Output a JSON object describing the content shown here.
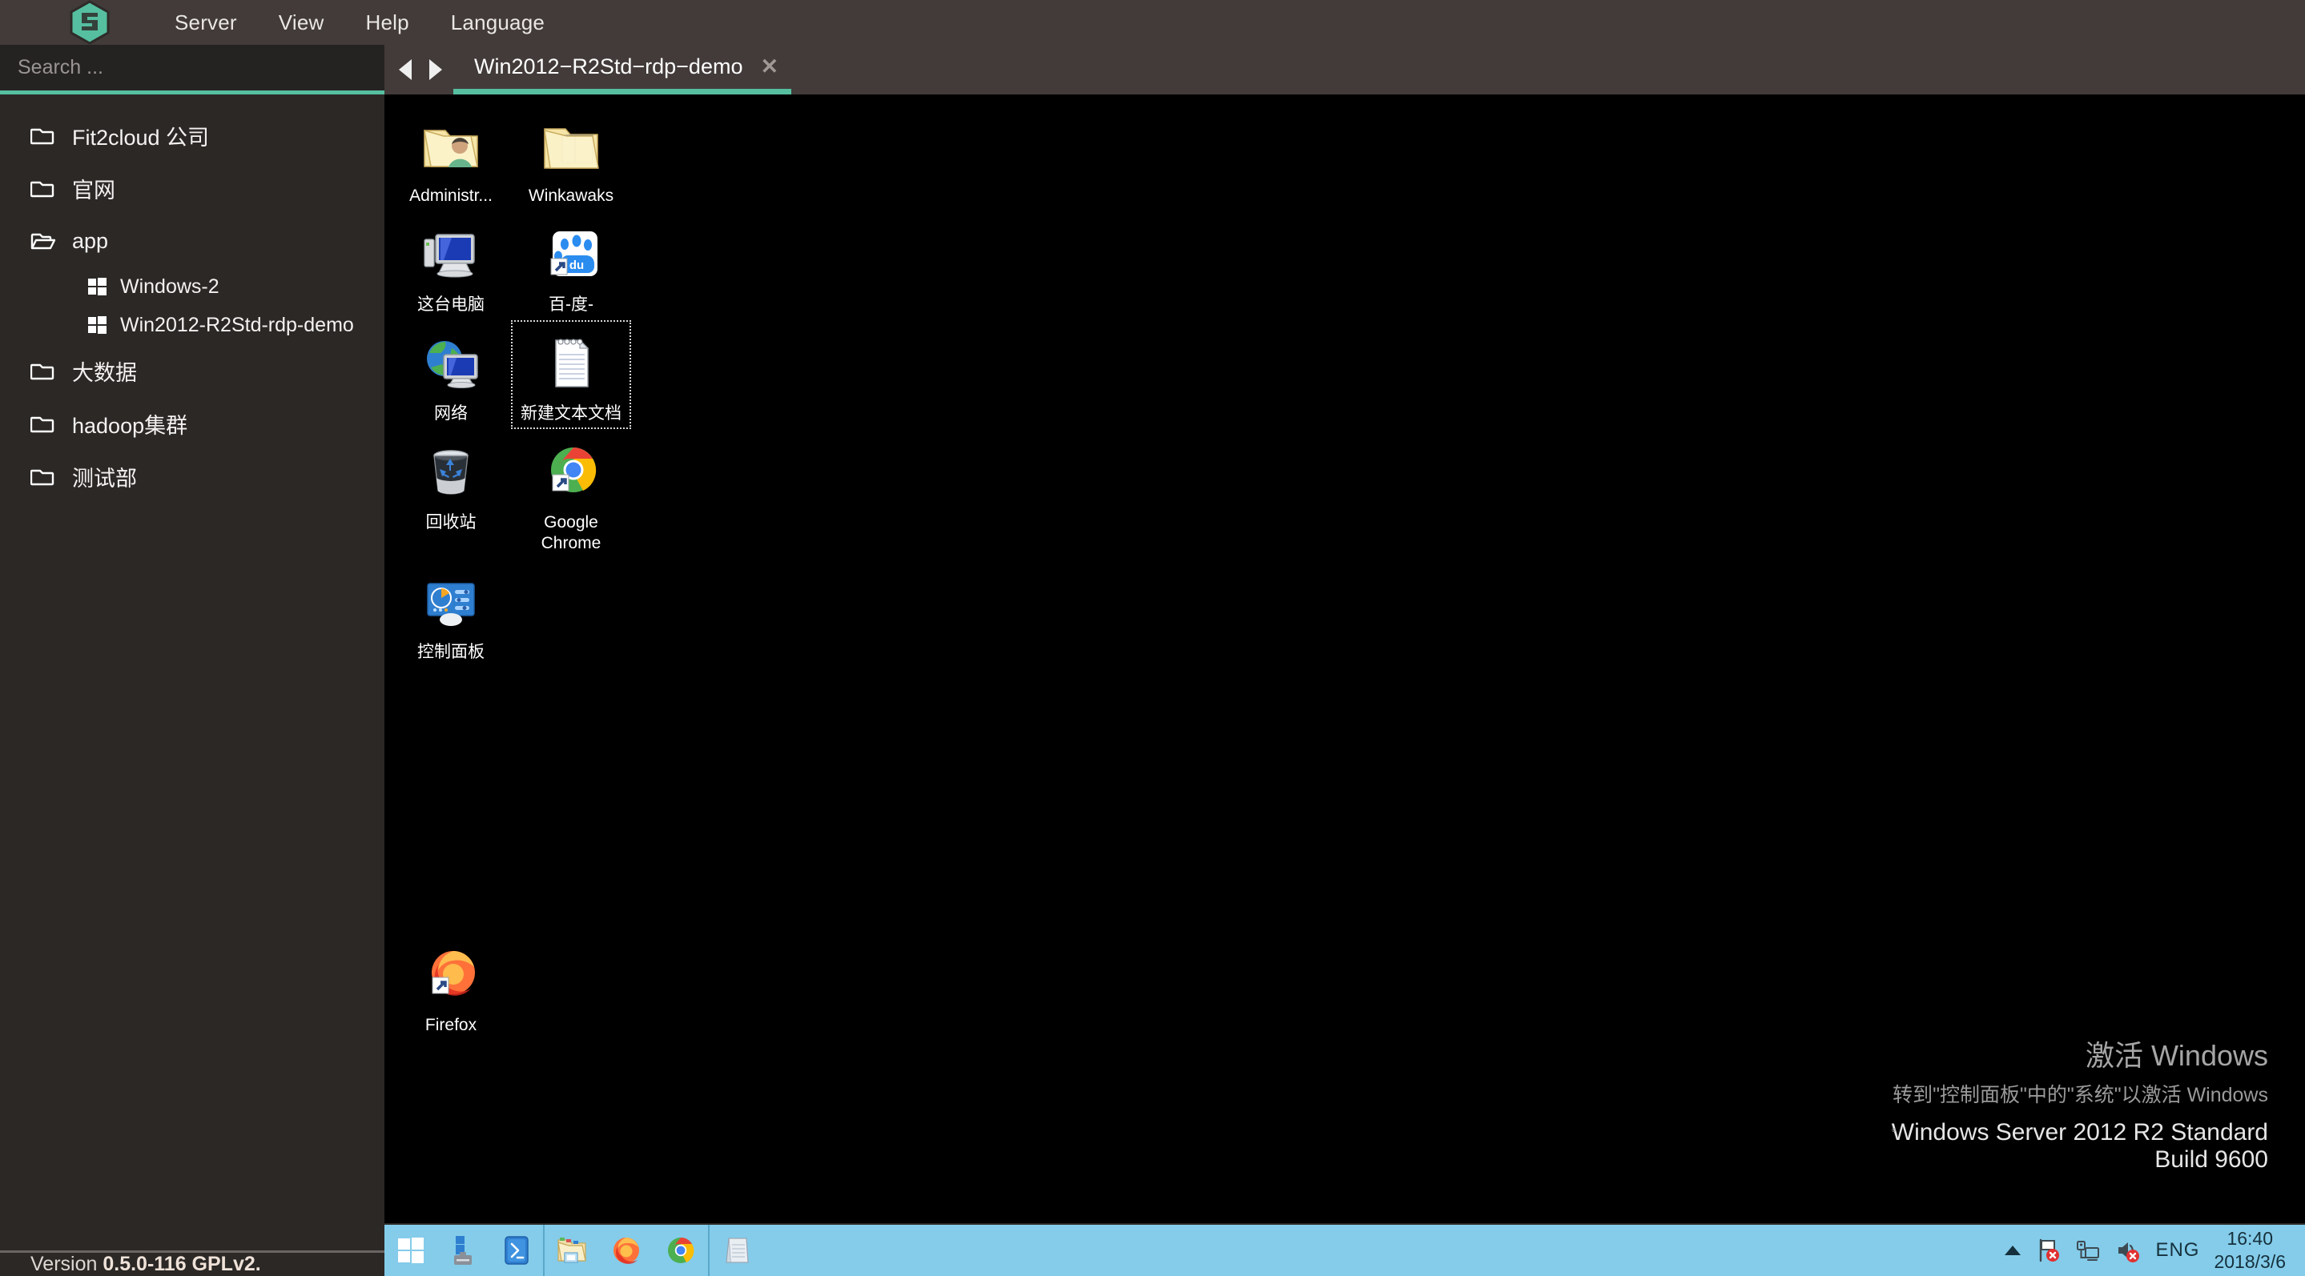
{
  "app": {
    "logo": "guacamole-logo",
    "version_prefix": "Version ",
    "version_value": "0.5.0-116 GPLv2."
  },
  "menubar": {
    "items": [
      {
        "label": "Server",
        "name": "menu-server"
      },
      {
        "label": "View",
        "name": "menu-view"
      },
      {
        "label": "Help",
        "name": "menu-help"
      },
      {
        "label": "Language",
        "name": "menu-language"
      }
    ]
  },
  "search": {
    "placeholder": "Search ...",
    "value": ""
  },
  "sidebar": {
    "accent_color": "#56bfa0",
    "items": [
      {
        "label": "Fit2cloud 公司",
        "icon": "folder-closed-icon",
        "expanded": false,
        "level": 0
      },
      {
        "label": "官网",
        "icon": "folder-closed-icon",
        "expanded": false,
        "level": 0
      },
      {
        "label": "app",
        "icon": "folder-open-icon",
        "expanded": true,
        "level": 0
      },
      {
        "label": "Windows-2",
        "icon": "windows-icon",
        "level": 1
      },
      {
        "label": "Win2012-R2Std-rdp-demo",
        "icon": "windows-icon",
        "level": 1
      },
      {
        "label": "大数据",
        "icon": "folder-closed-icon",
        "expanded": false,
        "level": 0
      },
      {
        "label": "hadoop集群",
        "icon": "folder-closed-icon",
        "expanded": false,
        "level": 0
      },
      {
        "label": "测试部",
        "icon": "folder-closed-icon",
        "expanded": false,
        "level": 0
      }
    ]
  },
  "tabbar": {
    "prev_icon": "arrow-left-icon",
    "next_icon": "arrow-right-icon",
    "tabs": [
      {
        "title": "Win2012−R2Std−rdp−demo",
        "active": true,
        "close_label": "✕"
      }
    ]
  },
  "desktop": {
    "background": "#000000",
    "rows": [
      [
        {
          "label": "Administr...",
          "icon": "user-folder-icon",
          "selected": false
        },
        {
          "label": "Winkawaks",
          "icon": "folder-files-icon",
          "selected": false
        }
      ],
      [
        {
          "label": "这台电脑",
          "icon": "this-pc-icon",
          "selected": false
        },
        {
          "label": "百-度-",
          "icon": "baidu-shortcut-icon",
          "selected": false
        }
      ],
      [
        {
          "label": "网络",
          "icon": "network-icon",
          "selected": false
        },
        {
          "label": "新建文本文档",
          "icon": "text-document-icon",
          "selected": true
        }
      ],
      [
        {
          "label": "回收站",
          "icon": "recycle-bin-icon",
          "selected": false
        },
        {
          "label": "Google Chrome",
          "icon": "chrome-shortcut-icon",
          "selected": false
        }
      ],
      [
        {
          "label": "控制面板",
          "icon": "control-panel-icon",
          "selected": false
        }
      ],
      [
        {
          "label": "Firefox",
          "icon": "firefox-shortcut-icon",
          "selected": false
        }
      ]
    ],
    "watermark": {
      "line1": "激活 Windows",
      "line2": "转到\"控制面板\"中的\"系统\"以激活 Windows",
      "dot": "。",
      "line3": "Windows Server 2012 R2 Standard",
      "line4": "Build 9600"
    }
  },
  "taskbar": {
    "background": "#84ccea",
    "buttons": [
      {
        "name": "start-button",
        "icon": "windows-start-icon"
      },
      {
        "name": "server-manager-button",
        "icon": "server-manager-icon"
      },
      {
        "name": "powershell-button",
        "icon": "powershell-icon"
      },
      {
        "name": "file-explorer-button",
        "icon": "file-explorer-icon"
      },
      {
        "name": "firefox-button",
        "icon": "firefox-icon"
      },
      {
        "name": "chrome-button",
        "icon": "chrome-icon"
      },
      {
        "name": "notepad-button",
        "icon": "notepad-icon"
      }
    ],
    "tray": {
      "expand_icon": "chevron-up-icon",
      "flag_icon": "action-center-flag-error-icon",
      "network_icon": "network-status-icon",
      "volume_icon": "volume-muted-icon",
      "language": "ENG",
      "time": "16:40",
      "date": "2018/3/6"
    }
  }
}
